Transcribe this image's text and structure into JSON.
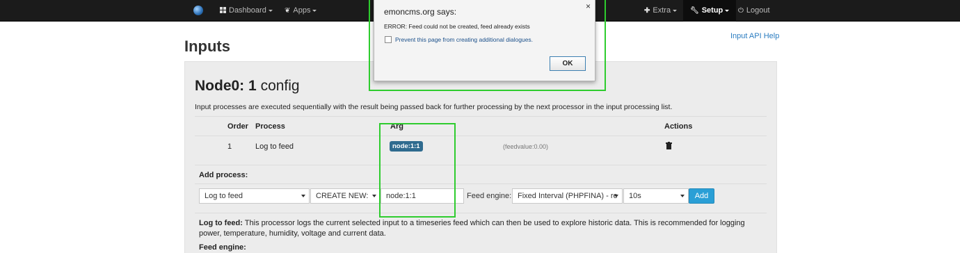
{
  "navbar": {
    "dashboard_label": "Dashboard",
    "apps_label": "Apps",
    "extra_label": "Extra",
    "setup_label": "Setup",
    "logout_label": "Logout"
  },
  "page": {
    "title": "Inputs",
    "api_help_link": "Input API Help"
  },
  "node": {
    "name": "Node0:",
    "id": "1",
    "suffix": "config",
    "description": "Input processes are executed sequentially with the result being passed back for further processing by the next processor in the input processing list."
  },
  "process_table": {
    "headers": {
      "order": "Order",
      "process": "Process",
      "arg": "Arg",
      "actions": "Actions"
    },
    "rows": [
      {
        "order": "1",
        "process": "Log to feed",
        "arg": "node:1:1",
        "feedvalue": "(feedvalue:0.00)"
      }
    ]
  },
  "add_process": {
    "label": "Add process:",
    "process_select": "Log to feed",
    "create_select": "CREATE NEW:",
    "feed_name_value": "node:1:1",
    "feed_engine_label": "Feed engine:",
    "feed_engine_select": "Fixed Interval (PHPFINA) - re",
    "interval_select": "10s",
    "add_button": "Add"
  },
  "process_help": {
    "title": "Log to feed:",
    "text": "This processor logs the current selected input to a timeseries feed which can then be used to explore historic data. This is recommended for logging power, temperature, humidity, voltage and current data.",
    "feed_engine_heading": "Feed engine:"
  },
  "dialog": {
    "title": "emoncms.org says:",
    "close": "×",
    "message": "ERROR: Feed could not be created, feed already exists",
    "checkbox_label": "Prevent this page from creating additional dialogues.",
    "ok_button": "OK"
  },
  "colors": {
    "highlight": "#2ecc2e",
    "link": "#2a7cc0",
    "badge": "#2f6b8f",
    "primary_button": "#2a9fd6"
  },
  "icons": [
    "globe-logo-icon",
    "dashboard-grid-icon",
    "apps-leaf-icon",
    "plus-icon",
    "wrench-icon",
    "power-icon",
    "trash-icon"
  ]
}
